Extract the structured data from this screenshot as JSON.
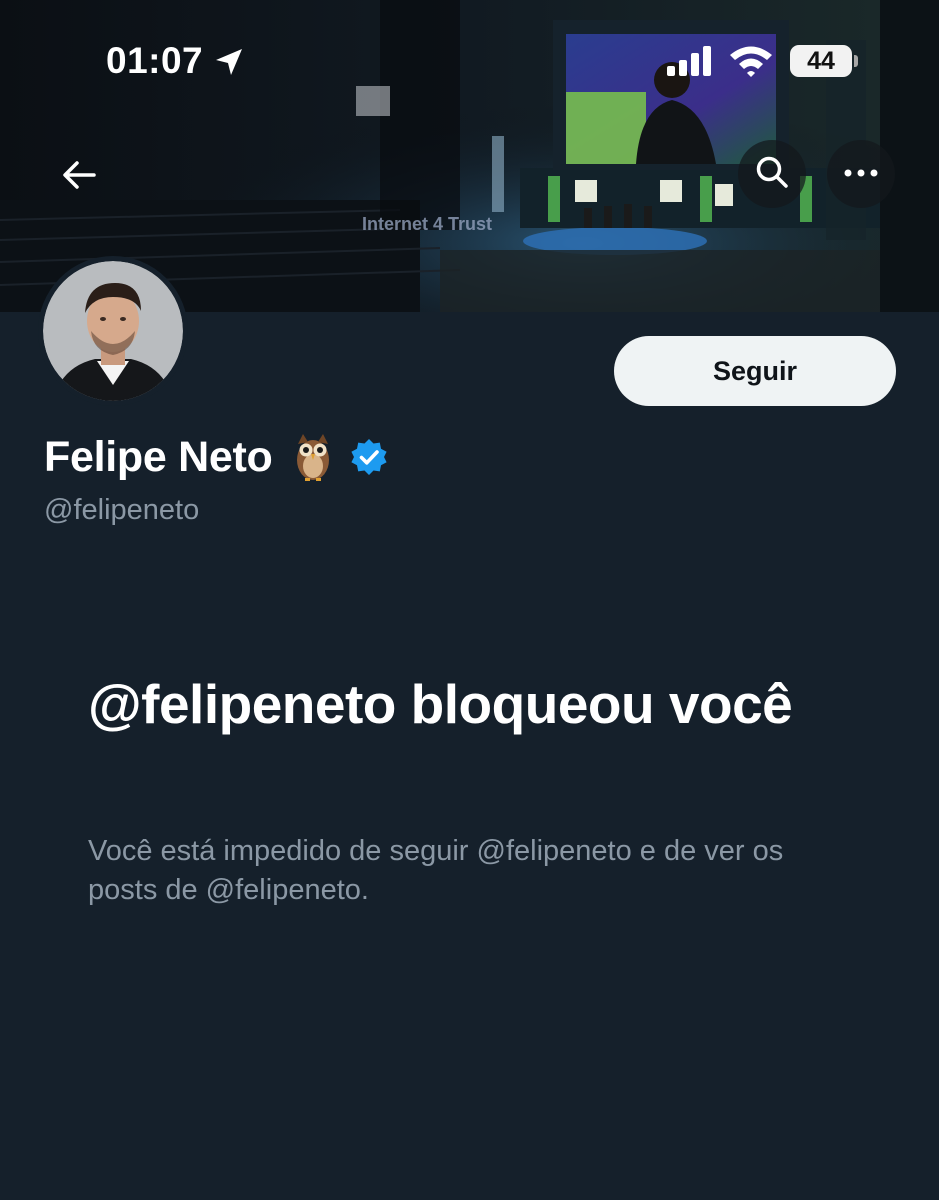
{
  "status_bar": {
    "time": "01:07",
    "battery": "44",
    "icons": [
      "location-arrow-icon",
      "cellular-signal-icon",
      "wifi-icon",
      "battery-icon"
    ]
  },
  "header": {
    "icons": [
      "back-arrow-icon",
      "search-icon",
      "more-icon"
    ]
  },
  "banner": {
    "stage_text": "Internet 4 Trust"
  },
  "profile": {
    "display_name": "Felipe Neto",
    "name_emoji": "owl",
    "verified": true,
    "handle": "@felipeneto",
    "follow_label": "Seguir"
  },
  "blocked": {
    "title": "@felipeneto bloqueou você",
    "description": "Você está impedido de seguir @felipeneto e de ver os posts de @felipeneto."
  },
  "colors": {
    "background": "#15202b",
    "primary_text": "#ffffff",
    "secondary_text": "#8b98a5",
    "follow_button_bg": "#eff3f4",
    "verified_badge": "#1d9bf0"
  }
}
